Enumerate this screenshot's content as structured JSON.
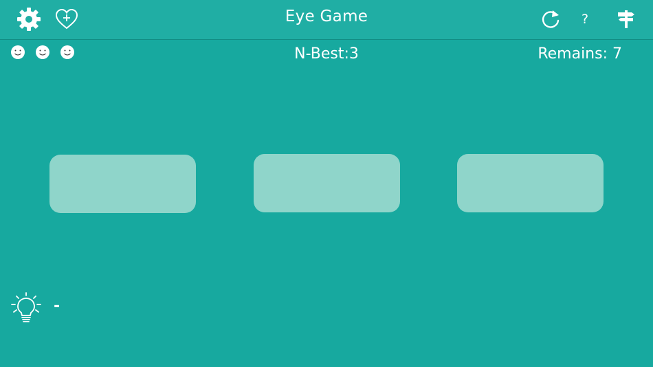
{
  "header": {
    "title": "Eye Game",
    "help_label": "?",
    "icons": [
      "gear-icon",
      "heart-plus-icon",
      "refresh-icon",
      "help-icon",
      "signpost-icon"
    ]
  },
  "status": {
    "lives_icons": [
      "smiley-icon",
      "smiley-icon",
      "smiley-icon"
    ],
    "best": "N-Best:3",
    "remains": "Remains: 7"
  },
  "board": {
    "cards": [
      {
        "state": "face-down"
      },
      {
        "state": "face-down"
      },
      {
        "state": "face-down"
      }
    ]
  },
  "hint": {
    "icon": "lightbulb-icon",
    "value": "-"
  },
  "colors": {
    "background": "#17a99f",
    "header": "#20aea4",
    "card": "#8fd5ca",
    "text": "#ffffff"
  }
}
